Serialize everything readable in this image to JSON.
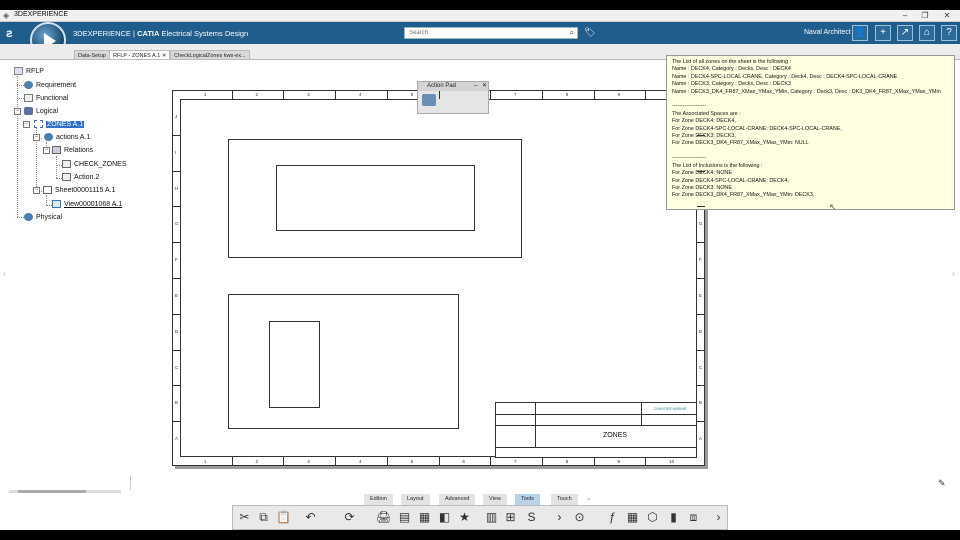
{
  "window": {
    "title": "3DEXPERIENCE",
    "controls": [
      "–",
      "❐",
      "✕"
    ]
  },
  "app": {
    "brand_part1": "3DEXPERIENCE | ",
    "brand_part2": "CATIA",
    "brand_part3": " Electrical Systems Design",
    "search_placeholder": "Search",
    "user": "Naval Architect",
    "accent": "#1f5d8c"
  },
  "tabs": [
    {
      "label": "Data-Setup"
    },
    {
      "label": "RFLP - ZONES A.1",
      "active": true,
      "close": "✕"
    },
    {
      "label": "CheckLogicalZones kws-ex..."
    }
  ],
  "tree": {
    "root": "RFLP",
    "requirement": "Requirement",
    "functional": "Functional",
    "logical": "Logical",
    "zones": "ZONES A.1",
    "actions": "actions A.1",
    "relations": "Relations",
    "check_zones": "CHECK_ZONES",
    "action2": "Action.2",
    "sheet": "Sheet00001115 A.1",
    "view": "View00001068 A.1",
    "physical": "Physical"
  },
  "action_pad": {
    "title": "Action Pad",
    "min": "–",
    "close": "✕"
  },
  "drawing": {
    "col_labels": [
      "1",
      "2",
      "3",
      "4",
      "5",
      "6",
      "7",
      "8",
      "9",
      "10"
    ],
    "row_labels": [
      "J",
      "I",
      "H",
      "G",
      "F",
      "E",
      "D",
      "C",
      "B",
      "A"
    ],
    "title_block": {
      "title": "ZONES",
      "logo": "CHANTIER MARINE"
    }
  },
  "tooltip": {
    "lines": [
      "The List of all zones on the sheet is the following :",
      " Name : DECK4,  Category : Decks,  Desc : DECK4",
      " Name : DECK4-SPC-LOCAL-CRANE,  Category : Deck4,  Desc : DECK4-SPC-LOCAL-CRANE",
      " Name : DECK3,  Category : Decks,  Desc : DECK3",
      " Name : DECK3_DK4_FR87_XMax_YMax_YMin,  Category : Deck3,  Desc : DK3_DK4_FR87_XMax_YMax_YMin",
      "",
      "-------------------",
      "The Associated Spaces are :",
      "  For Zone DECK4: DECK4,",
      "  For Zone DECK4-SPC-LOCAL-CRANE: DECK4-SPC-LOCAL-CRANE,",
      "  For Zone DECK3: DECK3,",
      "  For Zone DECK3_DK4_FR87_XMax_YMax_YMin: NULL",
      "",
      "-------------------",
      "The List of Inclusions is the following :",
      "  For Zone DECK4:  NONE",
      "  For Zone DECK4-SPC-LOCAL-CRANE:  DECK4,",
      "  For Zone DECK3:  NONE",
      "  For Zone DECK3_DK4_FR87_XMax_YMax_YMin:  DECK3,"
    ]
  },
  "section_tabs": [
    {
      "label": "Edition"
    },
    {
      "label": "Layout"
    },
    {
      "label": "Advanced"
    },
    {
      "label": "View"
    },
    {
      "label": "Tools",
      "active": true
    },
    {
      "label": "Touch"
    }
  ]
}
